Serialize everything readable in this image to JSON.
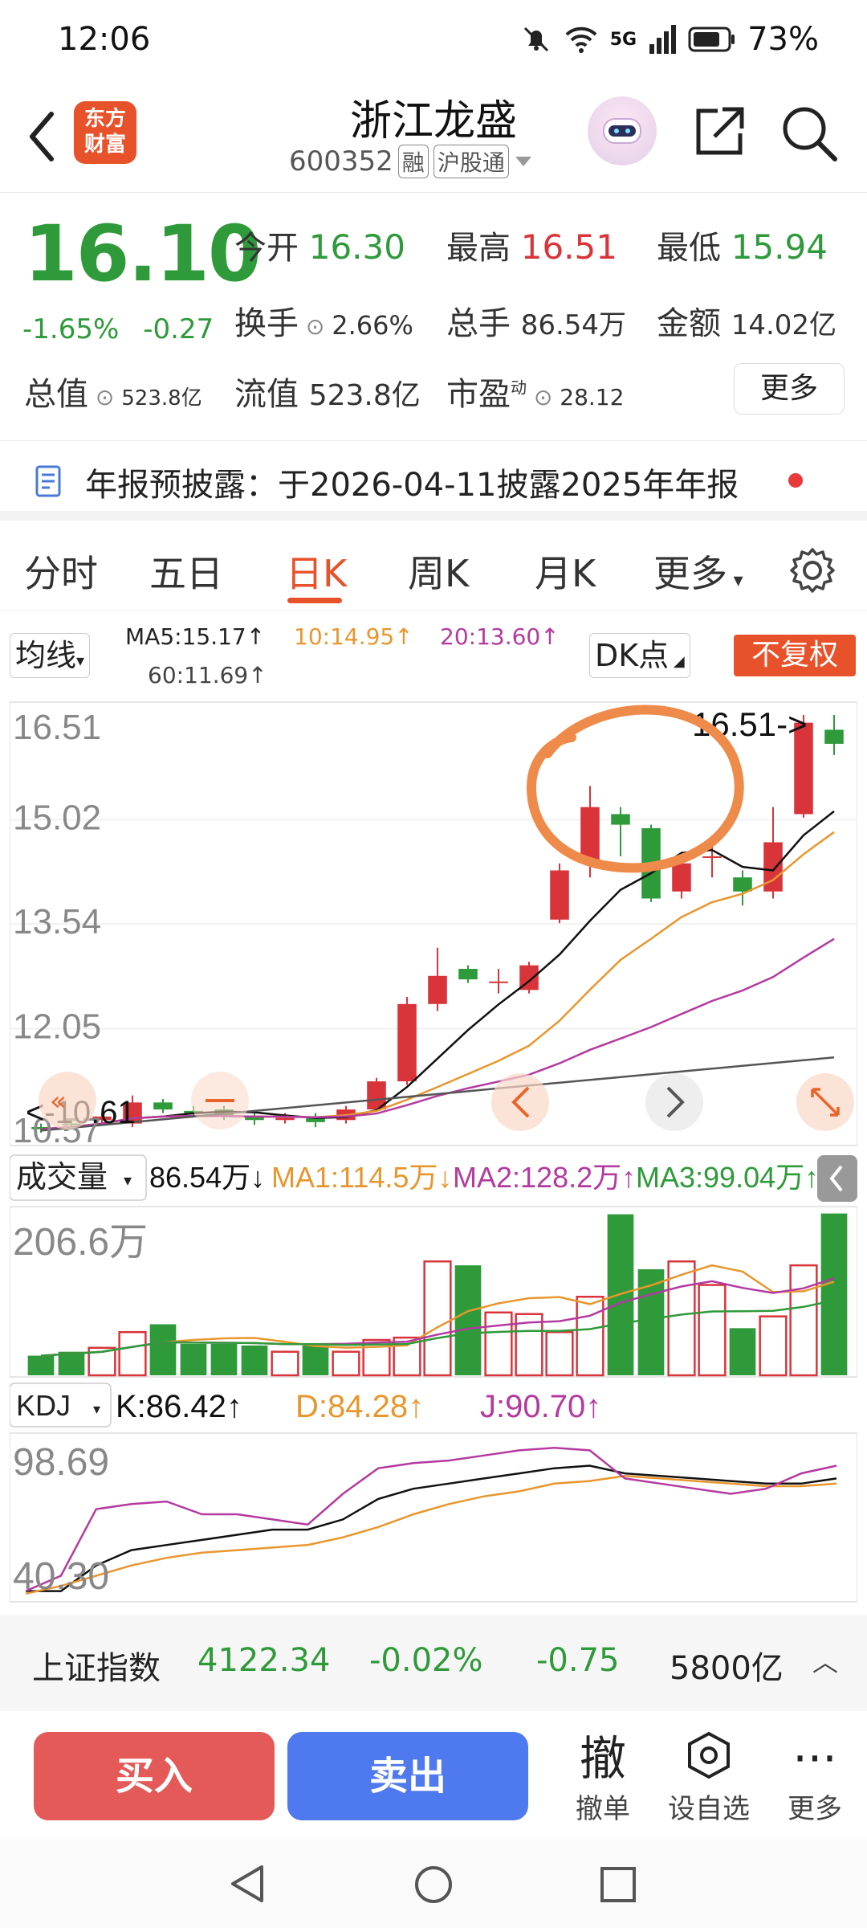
{
  "status_bar": {
    "time": "12:06",
    "network": "5G",
    "battery": "73%"
  },
  "header": {
    "title": "浙江龙盛",
    "code": "600352",
    "tag1": "融",
    "tag2": "沪股通",
    "logo_line1": "东方",
    "logo_line2": "财富"
  },
  "quote": {
    "price": "16.10",
    "change_pct": "-1.65%",
    "change_abs": "-0.27",
    "open_label": "今开",
    "open": "16.30",
    "high_label": "最高",
    "high": "16.51",
    "low_label": "最低",
    "low": "15.94",
    "turnover_label": "换手",
    "turnover": "2.66%",
    "volume_label": "总手",
    "volume": "86.54万",
    "amount_label": "金额",
    "amount": "14.02亿",
    "mktcap_label": "总值",
    "mktcap": "523.8亿",
    "float_label": "流值",
    "float_cap": "523.8亿",
    "pe_label": "市盈",
    "pe_sup": "动",
    "pe": "28.12",
    "more": "更多"
  },
  "notice": {
    "text": "年报预披露：于2026-04-11披露2025年年报"
  },
  "tabs": [
    "分时",
    "五日",
    "日K",
    "周K",
    "月K",
    "更多"
  ],
  "active_tab": "日K",
  "ma_legend": {
    "selector": "均线",
    "ma5": "MA5:15.17↑",
    "ma10": "10:14.95↑",
    "ma20": "20:13.60↑",
    "ma60": "60:11.69↑",
    "dk": "DK点",
    "fq": "不复权"
  },
  "price_axis": [
    "16.51",
    "15.02",
    "13.54",
    "12.05",
    "10.57"
  ],
  "high_mark": "16.51->",
  "low_mark": "<-10.61",
  "volume_legend": {
    "selector": "成交量",
    "vol": "86.54万↓",
    "ma1": "MA1:114.5万↓",
    "ma2": "MA2:128.2万↑",
    "ma3": "MA3:99.04万↑",
    "axis_max": "206.6万"
  },
  "kdj_legend": {
    "selector": "KDJ",
    "k": "K:86.42↑",
    "d": "D:84.28↑",
    "j": "J:90.70↑",
    "axis_max": "98.69",
    "axis_min": "40.30"
  },
  "index_bar": {
    "name": "上证指数",
    "value": "4122.34",
    "pct": "-0.02%",
    "chg": "-0.75",
    "turnover": "5800亿"
  },
  "trade_bar": {
    "buy": "买入",
    "sell": "卖出",
    "cancel_icon": "撤",
    "cancel": "撤单",
    "watch": "设自选",
    "more": "更多"
  },
  "colors": {
    "up": "#d8343a",
    "down": "#2e9a3a",
    "accent": "#e8522a",
    "ma5": "#111111",
    "ma10": "#e8962e",
    "ma20": "#b43aa0",
    "ma60": "#555555"
  },
  "chart_data": {
    "type": "candlestick",
    "candles": [
      {
        "o": 10.65,
        "c": 10.62,
        "h": 10.7,
        "l": 10.57
      },
      {
        "o": 10.7,
        "c": 10.68,
        "h": 10.75,
        "l": 10.62
      },
      {
        "o": 10.75,
        "c": 10.8,
        "h": 10.85,
        "l": 10.7
      },
      {
        "o": 10.7,
        "c": 11.0,
        "h": 11.1,
        "l": 10.65
      },
      {
        "o": 11.0,
        "c": 10.9,
        "h": 11.05,
        "l": 10.85
      },
      {
        "o": 10.88,
        "c": 10.85,
        "h": 10.95,
        "l": 10.8
      },
      {
        "o": 10.9,
        "c": 10.8,
        "h": 10.95,
        "l": 10.75
      },
      {
        "o": 10.8,
        "c": 10.75,
        "h": 10.85,
        "l": 10.68
      },
      {
        "o": 10.75,
        "c": 10.78,
        "h": 10.85,
        "l": 10.7
      },
      {
        "o": 10.8,
        "c": 10.72,
        "h": 10.85,
        "l": 10.65
      },
      {
        "o": 10.75,
        "c": 10.9,
        "h": 10.95,
        "l": 10.7
      },
      {
        "o": 10.9,
        "c": 11.3,
        "h": 11.35,
        "l": 10.88
      },
      {
        "o": 11.3,
        "c": 12.4,
        "h": 12.5,
        "l": 11.25
      },
      {
        "o": 12.4,
        "c": 12.8,
        "h": 13.2,
        "l": 12.3
      },
      {
        "o": 12.9,
        "c": 12.75,
        "h": 12.95,
        "l": 12.7
      },
      {
        "o": 12.7,
        "c": 12.72,
        "h": 12.9,
        "l": 12.55
      },
      {
        "o": 12.6,
        "c": 12.95,
        "h": 13.0,
        "l": 12.55
      },
      {
        "o": 13.6,
        "c": 14.3,
        "h": 14.4,
        "l": 13.55
      },
      {
        "o": 14.4,
        "c": 15.2,
        "h": 15.5,
        "l": 14.2
      },
      {
        "o": 15.1,
        "c": 14.95,
        "h": 15.2,
        "l": 14.5
      },
      {
        "o": 14.9,
        "c": 13.9,
        "h": 14.95,
        "l": 13.85
      },
      {
        "o": 14.0,
        "c": 14.4,
        "h": 14.5,
        "l": 13.9
      },
      {
        "o": 14.5,
        "c": 14.5,
        "h": 14.7,
        "l": 14.2
      },
      {
        "o": 14.2,
        "c": 14.0,
        "h": 14.3,
        "l": 13.8
      },
      {
        "o": 14.0,
        "c": 14.7,
        "h": 15.2,
        "l": 13.9
      },
      {
        "o": 15.1,
        "c": 16.4,
        "h": 16.51,
        "l": 15.05
      },
      {
        "o": 16.3,
        "c": 16.1,
        "h": 16.51,
        "l": 15.94
      }
    ],
    "volumes": [
      25,
      30,
      35,
      55,
      65,
      40,
      40,
      38,
      30,
      38,
      30,
      45,
      48,
      145,
      140,
      80,
      78,
      55,
      100,
      205,
      135,
      145,
      115,
      60,
      75,
      140,
      206,
      86.54
    ],
    "kdj_k": [
      42,
      42,
      52,
      58,
      60,
      62,
      64,
      66,
      66,
      70,
      78,
      82,
      84,
      86,
      88,
      90,
      91,
      88,
      87,
      86,
      85,
      84,
      84,
      86
    ],
    "kdj_d": [
      41,
      44,
      48,
      52,
      55,
      57,
      58,
      59,
      60,
      63,
      67,
      72,
      76,
      79,
      81,
      84,
      85,
      87,
      86,
      85,
      84,
      83,
      83,
      84
    ],
    "kdj_j": [
      42,
      48,
      74,
      76,
      77,
      72,
      72,
      70,
      68,
      80,
      90,
      92,
      93,
      95,
      97,
      98,
      97,
      86,
      84,
      82,
      80,
      82,
      88,
      91
    ],
    "ylim": [
      10.57,
      16.51
    ]
  }
}
